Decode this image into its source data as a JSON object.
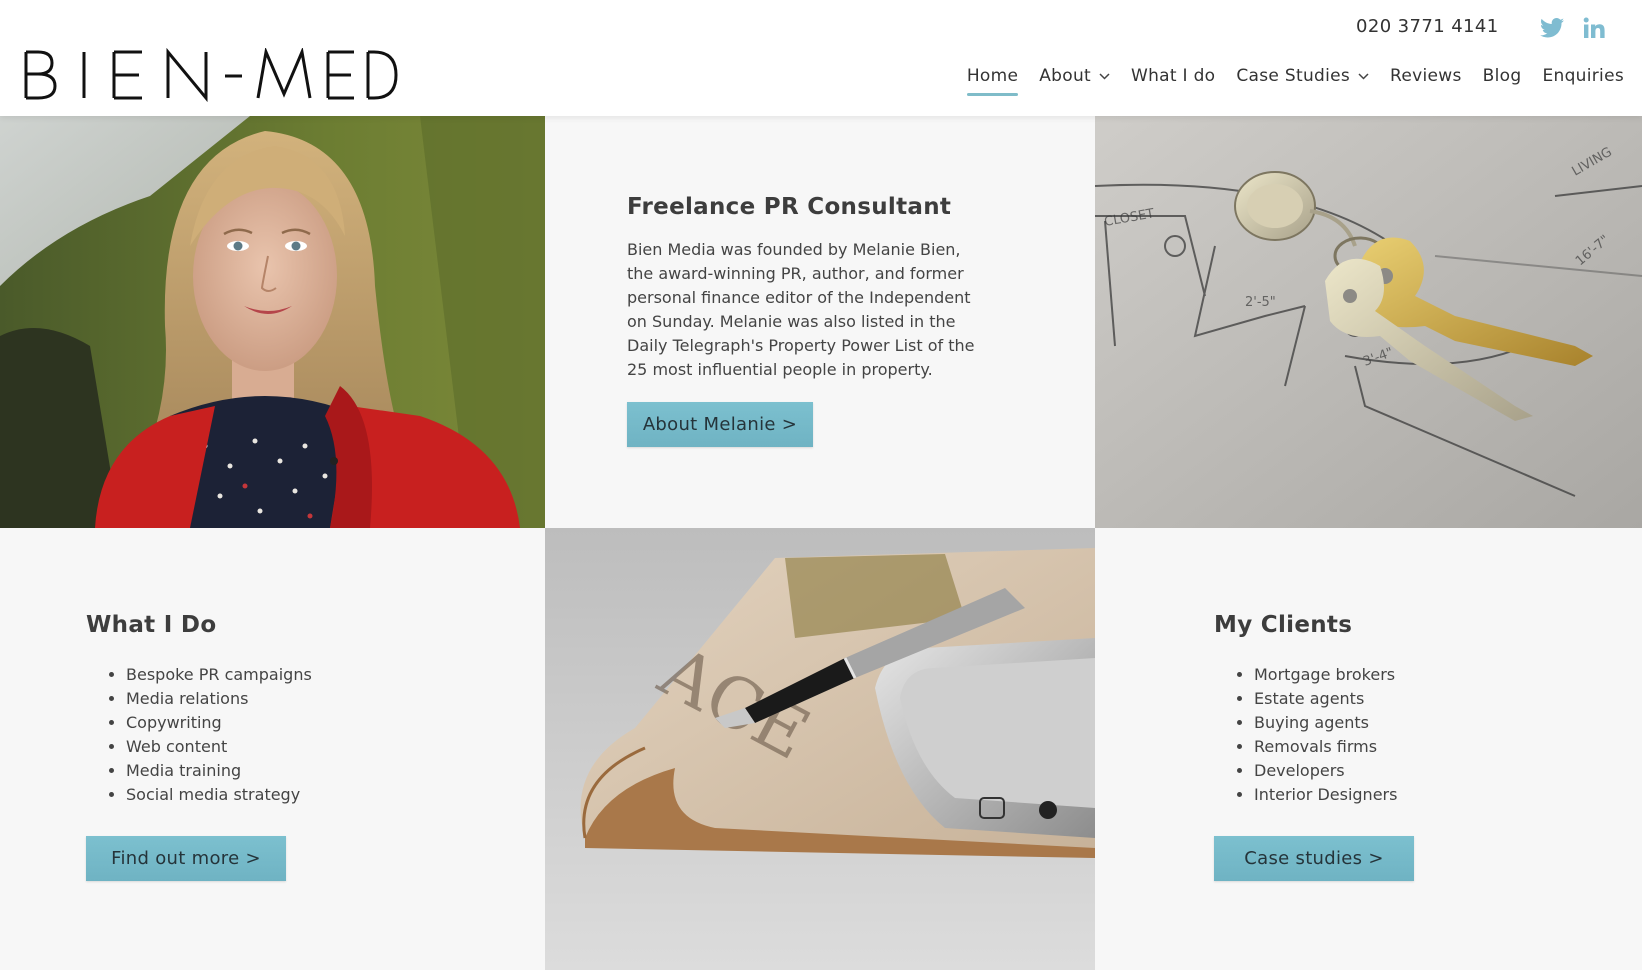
{
  "header": {
    "logo_text": "BIEN-MEDIA",
    "phone": "020 3771 4141",
    "social": [
      {
        "name": "twitter-icon",
        "color": "#7fbcd1"
      },
      {
        "name": "linkedin-icon",
        "color": "#7fbcd1"
      }
    ],
    "nav": [
      {
        "label": "Home",
        "active": true,
        "dropdown": false
      },
      {
        "label": "About",
        "active": false,
        "dropdown": true
      },
      {
        "label": "What I do",
        "active": false,
        "dropdown": false
      },
      {
        "label": "Case Studies",
        "active": false,
        "dropdown": true
      },
      {
        "label": "Reviews",
        "active": false,
        "dropdown": false
      },
      {
        "label": "Blog",
        "active": false,
        "dropdown": false
      },
      {
        "label": "Enquiries",
        "active": false,
        "dropdown": false
      }
    ]
  },
  "intro": {
    "title": "Freelance PR Consultant",
    "text": "Bien Media was founded by Melanie Bien, the award-winning PR, author, and former personal finance editor of the Independent on Sunday. Melanie was also listed in the Daily Telegraph's Property Power List of the 25 most influential people in property.",
    "button": "About Melanie >"
  },
  "what_i_do": {
    "title": "What I Do",
    "items": [
      "Bespoke PR campaigns",
      "Media relations",
      "Copywriting",
      "Web content",
      "Media training",
      "Social media strategy"
    ],
    "button": "Find out more >"
  },
  "clients": {
    "title": "My Clients",
    "items": [
      "Mortgage brokers",
      "Estate agents",
      "Buying agents",
      "Removals firms",
      "Developers",
      "Interior Designers"
    ],
    "button": "Case studies >"
  },
  "colors": {
    "accent": "#7fbcc9",
    "button": "#75b9c8",
    "coat_red": "#c8201f"
  }
}
